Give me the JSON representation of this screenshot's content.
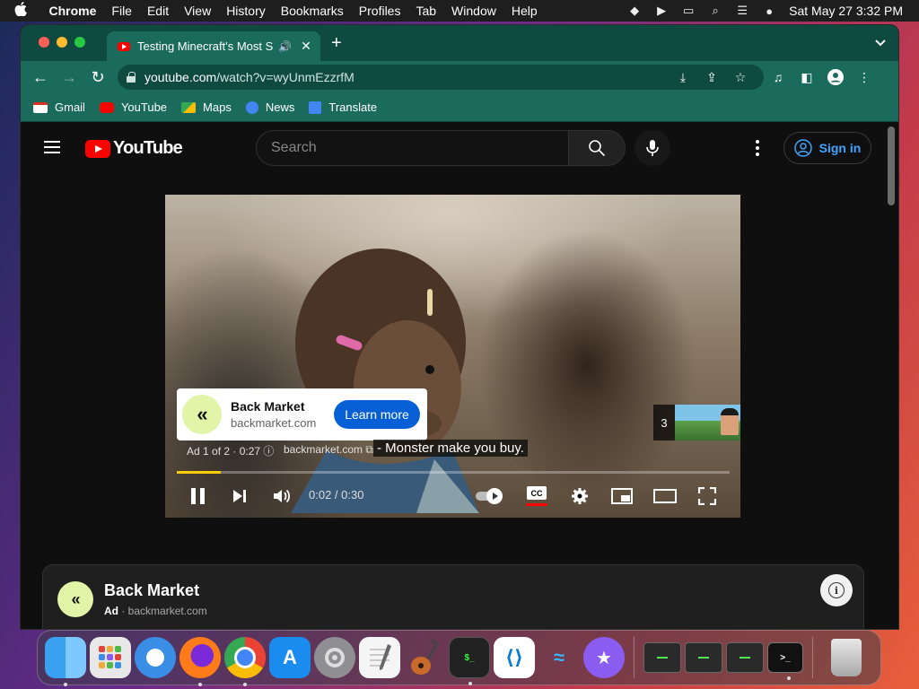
{
  "menubar": {
    "apple": "",
    "items": [
      "Chrome",
      "File",
      "Edit",
      "View",
      "History",
      "Bookmarks",
      "Profiles",
      "Tab",
      "Window",
      "Help"
    ],
    "clock": "Sat May 27  3:32 PM"
  },
  "browser": {
    "tab": {
      "title": "Testing Minecraft's Most S",
      "audio": "🔊",
      "close": "✕"
    },
    "newtab": "+",
    "tabsearch": "⌄",
    "nav": {
      "back": "←",
      "forward": "→",
      "reload": "↻"
    },
    "url": {
      "host": "youtube.com",
      "path": "/watch?v=wyUnmEzzrfM"
    },
    "bookmarks": [
      {
        "label": "Gmail",
        "icon": "gmail-icon"
      },
      {
        "label": "YouTube",
        "icon": "youtube-icon"
      },
      {
        "label": "Maps",
        "icon": "maps-icon"
      },
      {
        "label": "News",
        "icon": "news-icon"
      },
      {
        "label": "Translate",
        "icon": "translate-icon"
      }
    ]
  },
  "youtube": {
    "logo_text": "YouTube",
    "search_placeholder": "Search",
    "signin_label": "Sign in",
    "player": {
      "ad_card": {
        "name": "Back Market",
        "domain": "backmarket.com",
        "cta": "Learn more",
        "logo": "«"
      },
      "ad_info": "Ad 1 of 2 · 0:27  ⓘ",
      "ad_domain": "backmarket.com ⧉",
      "subtitle": "- Monster make you buy.",
      "next_count": "3",
      "progress": 0.08,
      "time": "0:02 / 0:30",
      "cc_label": "CC"
    },
    "companion": {
      "name": "Back Market",
      "ad_label": "Ad",
      "domain": "· backmarket.com",
      "logo": "«",
      "info": "i"
    }
  },
  "dock": {
    "apps": [
      "Finder",
      "Launchpad",
      "Safari",
      "Firefox",
      "Chrome",
      "App Store",
      "System Settings",
      "TextEdit",
      "GarageBand",
      "Terminal",
      "VS Code",
      "Dolphin",
      "iMovie"
    ],
    "appstore_glyph": "A",
    "terminal_glyph": "$_",
    "vscode_glyph": "⟨⟩",
    "dolphin_glyph": "≈",
    "imovie_glyph": "★",
    "term_glyph": ">_"
  },
  "colors": {
    "tab_bar": "#0e4a40",
    "toolbar": "#1b6b5c",
    "youtube_red": "#ff0000",
    "link_blue": "#3ea6ff",
    "cta_blue": "#065fd4",
    "progress_yellow": "#ffcc00"
  }
}
